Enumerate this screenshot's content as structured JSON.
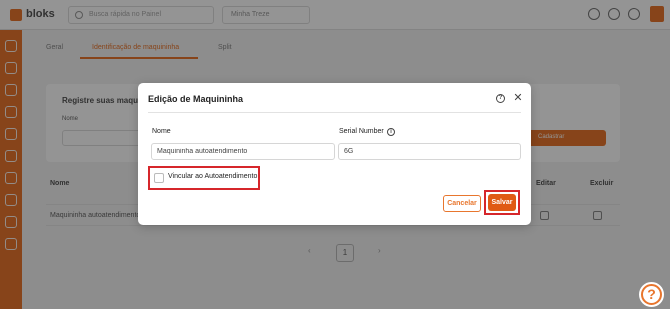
{
  "app": {
    "logo_text": "bloks"
  },
  "search": {
    "placeholder": "Busca rápida no Painel"
  },
  "store_select": {
    "value": "Minha Treze"
  },
  "tabs": [
    "Geral",
    "Identificação de maquininha",
    "Split"
  ],
  "background_card": {
    "title": "Registre suas maquininhas",
    "label": "Nome",
    "button_label": "Cadastrar"
  },
  "table": {
    "headers": [
      "Nome",
      "Editar",
      "Excluir"
    ],
    "rows": [
      {
        "name": "Maquininha autoatendimento"
      }
    ]
  },
  "pagination": {
    "prev": "‹",
    "page": "1",
    "next": "›"
  },
  "modal": {
    "title": "Edição de Maquininha",
    "help_symbol": "?",
    "close_symbol": "✕",
    "fields": {
      "nome": {
        "label": "Nome",
        "value": "Maquininha autoatendimento"
      },
      "serial": {
        "label": "Serial Number",
        "value": "6G"
      }
    },
    "info_symbol": "i",
    "checkbox_label": "Vincular ao Autoatendimento",
    "cancel_label": "Cancelar",
    "save_label": "Salvar"
  },
  "help_fab": {
    "symbol": "?"
  },
  "colors": {
    "accent": "#e8762e",
    "highlight": "#d6262b",
    "save": "#e05a14"
  },
  "icons": [
    "search-icon",
    "help-icon",
    "close-icon",
    "info-icon",
    "edit-icon",
    "trash-icon",
    "bell-icon",
    "settings-icon",
    "user-icon"
  ]
}
